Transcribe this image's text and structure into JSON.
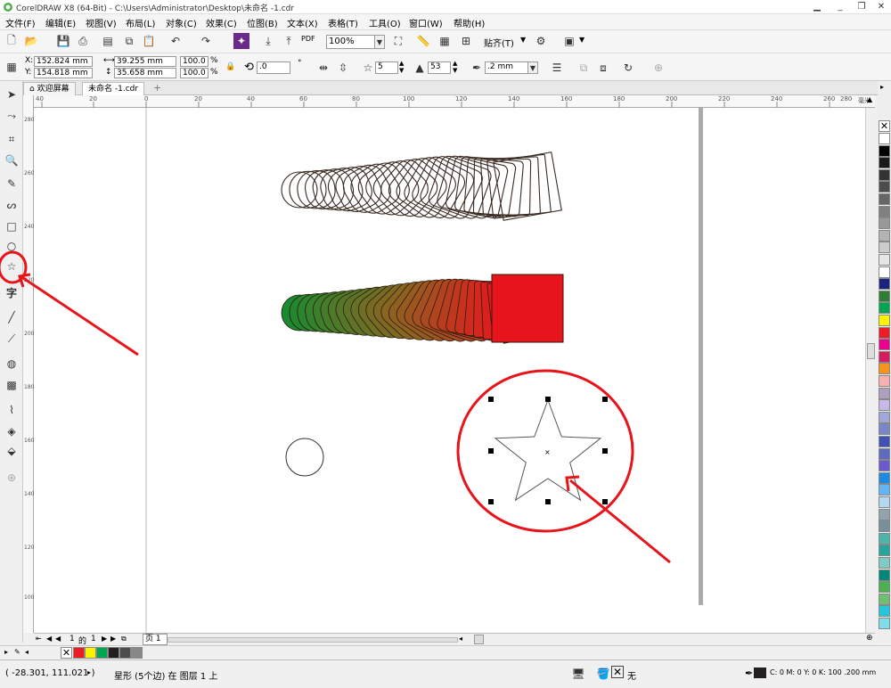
{
  "window": {
    "title": "CorelDRAW X8 (64-Bit) - C:\\Users\\Administrator\\Desktop\\未命名 -1.cdr"
  },
  "menu": [
    "文件(F)",
    "编辑(E)",
    "视图(V)",
    "布局(L)",
    "对象(C)",
    "效果(C)",
    "位图(B)",
    "文本(X)",
    "表格(T)",
    "工具(O)",
    "窗口(W)",
    "帮助(H)"
  ],
  "standard": {
    "zoom": "100%",
    "pdf_label": "PDF",
    "snap_label": "贴齐(T)"
  },
  "properties": {
    "x": "152.824 mm",
    "y": "154.818 mm",
    "x_label": "X:",
    "y_label": "Y:",
    "width": "39.255 mm",
    "height": "35.658 mm",
    "scale_w": "100.0",
    "scale_h": "100.0",
    "percent": "%",
    "rotation": ".0",
    "degree": "°",
    "points": "5",
    "sharpness": "53",
    "outline": ".2 mm"
  },
  "tabs": {
    "welcome": "欢迎屏幕",
    "document": "未命名 -1.cdr",
    "add": "+"
  },
  "ruler": {
    "h_ticks": [
      "40",
      "20",
      "0",
      "20",
      "40",
      "60",
      "80",
      "100",
      "120",
      "140",
      "160",
      "180",
      "200",
      "220",
      "240",
      "260",
      "280"
    ],
    "h_unit": "毫米",
    "v_ticks": [
      "280",
      "260",
      "240",
      "220",
      "200",
      "180",
      "160",
      "140",
      "120",
      "100"
    ]
  },
  "page_nav": {
    "current": "1",
    "of": "的",
    "total": "1",
    "page_tab": "页 1"
  },
  "status": {
    "cursor": "( -28.301, 111.021 )",
    "selection": "星形 (5个边) 在 图层 1 上",
    "fill": "无",
    "outline_info": "C: 0 M: 0 Y: 0 K: 100  .200 mm"
  },
  "colors": {
    "accent_red": "#e8141c",
    "palette": [
      "#ffffff",
      "#000000",
      "#1a1a1a",
      "#333333",
      "#4d4d4d",
      "#666666",
      "#808080",
      "#999999",
      "#b3b3b3",
      "#cccccc",
      "#e6e6e6",
      "#ffffff",
      "#1a237e",
      "#2e7d32",
      "#00a651",
      "#fff200",
      "#ed1c24",
      "#ec008c",
      "#d81b60",
      "#f7941d",
      "#f8b0b0",
      "#b0a0c0",
      "#c8b8e8",
      "#9fa8da",
      "#7986cb",
      "#3f51b5",
      "#5c6bc0",
      "#6a5acd",
      "#1e88e5",
      "#64b5f6",
      "#b3d9f2",
      "#90a4ae",
      "#78909c",
      "#4db6ac",
      "#26a69a",
      "#80cbc4",
      "#00897b",
      "#4caf50",
      "#6fbf73",
      "#26c6da",
      "#80deea"
    ],
    "doc_palette": [
      "#ed1c24",
      "#fff200",
      "#00a651",
      "#231f20",
      "#4d4d4d",
      "#888888"
    ]
  },
  "icons": {
    "star_tool": "star-icon",
    "text_tool": "字"
  }
}
